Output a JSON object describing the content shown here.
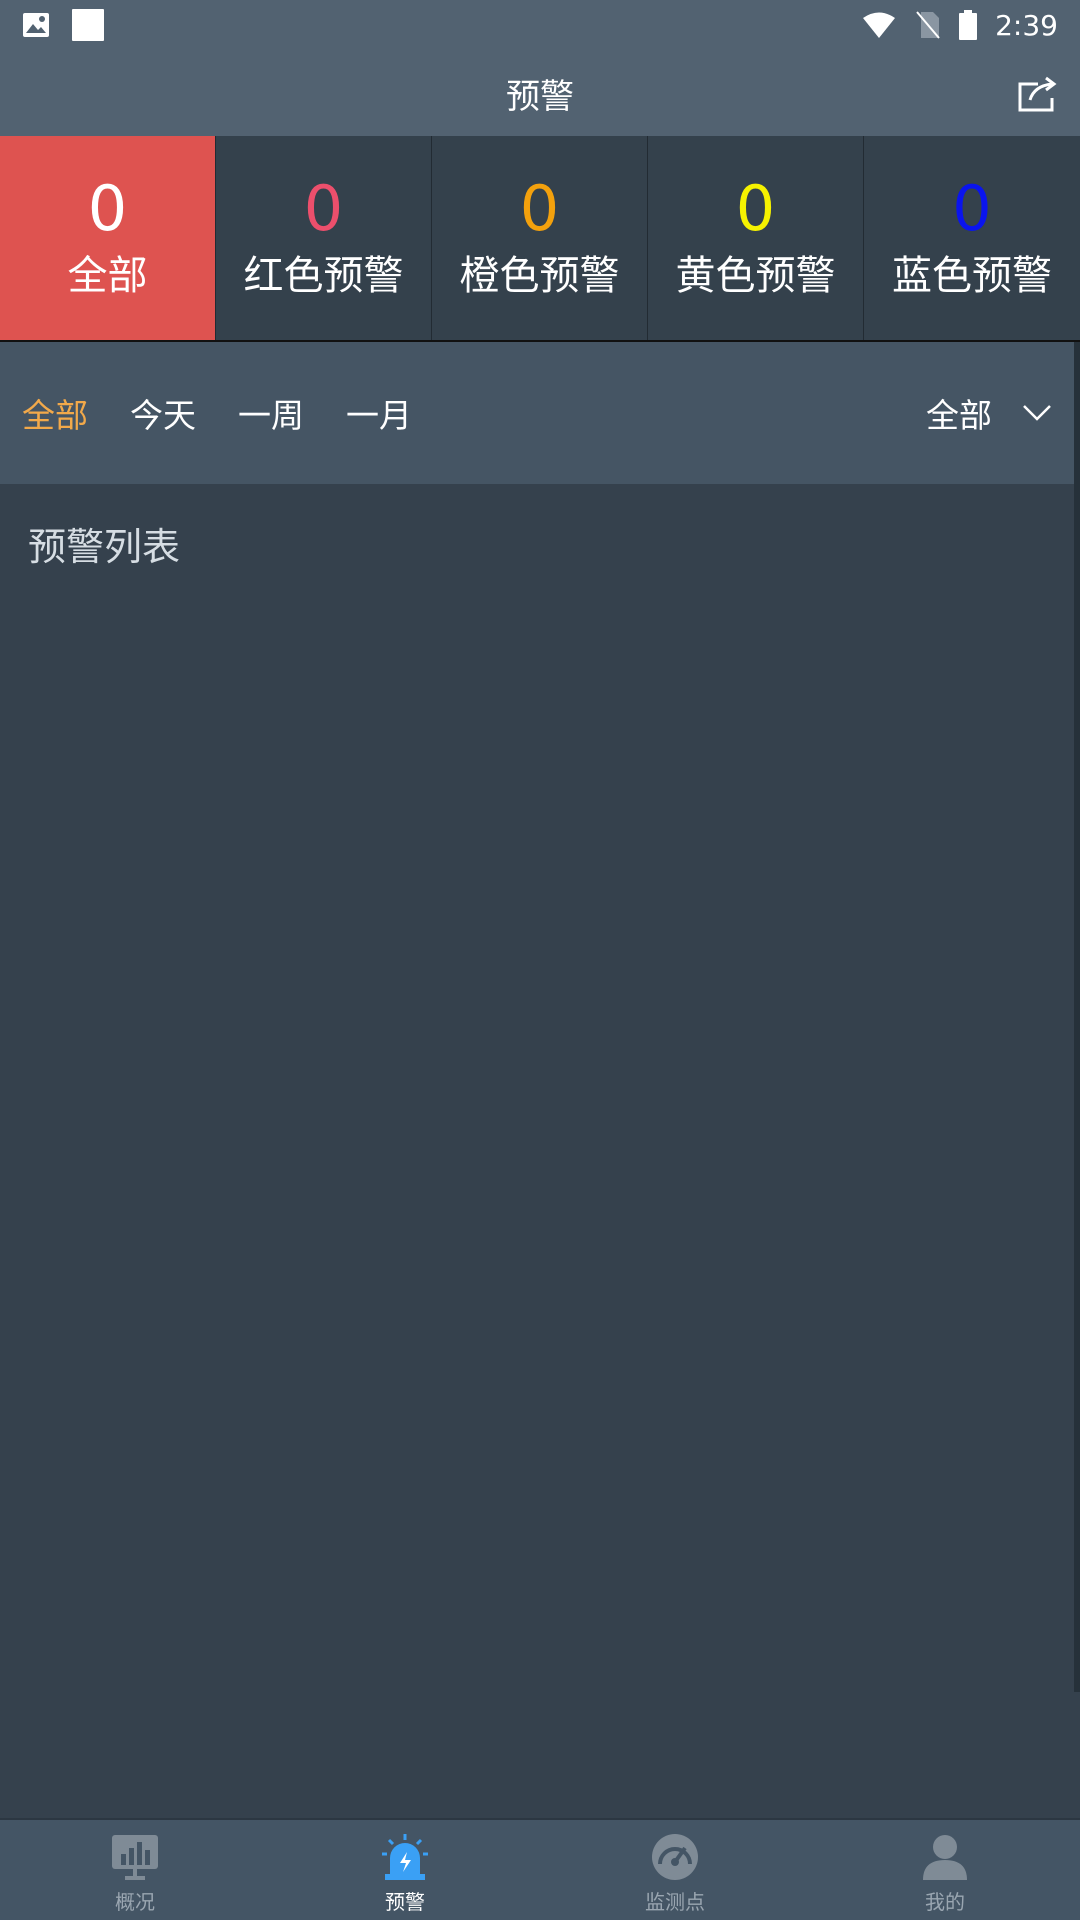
{
  "status_bar": {
    "time": "2:39"
  },
  "app_bar": {
    "title": "预警"
  },
  "stats": [
    {
      "count": "0",
      "label": "全部",
      "color": "#ffffff",
      "active": true
    },
    {
      "count": "0",
      "label": "红色预警",
      "color": "#ec4f6c"
    },
    {
      "count": "0",
      "label": "橙色预警",
      "color": "#f3a10d"
    },
    {
      "count": "0",
      "label": "黄色预警",
      "color": "#f6f200"
    },
    {
      "count": "0",
      "label": "蓝色预警",
      "color": "#0a14ee"
    }
  ],
  "filters": {
    "tabs": [
      "全部",
      "今天",
      "一周",
      "一月"
    ],
    "active_tab": "全部",
    "dropdown_value": "全部"
  },
  "list": {
    "title": "预警列表"
  },
  "bottom_nav": [
    {
      "label": "概况",
      "icon": "chart-icon"
    },
    {
      "label": "预警",
      "icon": "alarm-icon",
      "active": true
    },
    {
      "label": "监测点",
      "icon": "gauge-icon"
    },
    {
      "label": "我的",
      "icon": "user-icon"
    }
  ],
  "colors": {
    "accent_active_tab": "#f2a94a",
    "active_tile": "#de5350",
    "active_nav": "#3aa0f5"
  }
}
